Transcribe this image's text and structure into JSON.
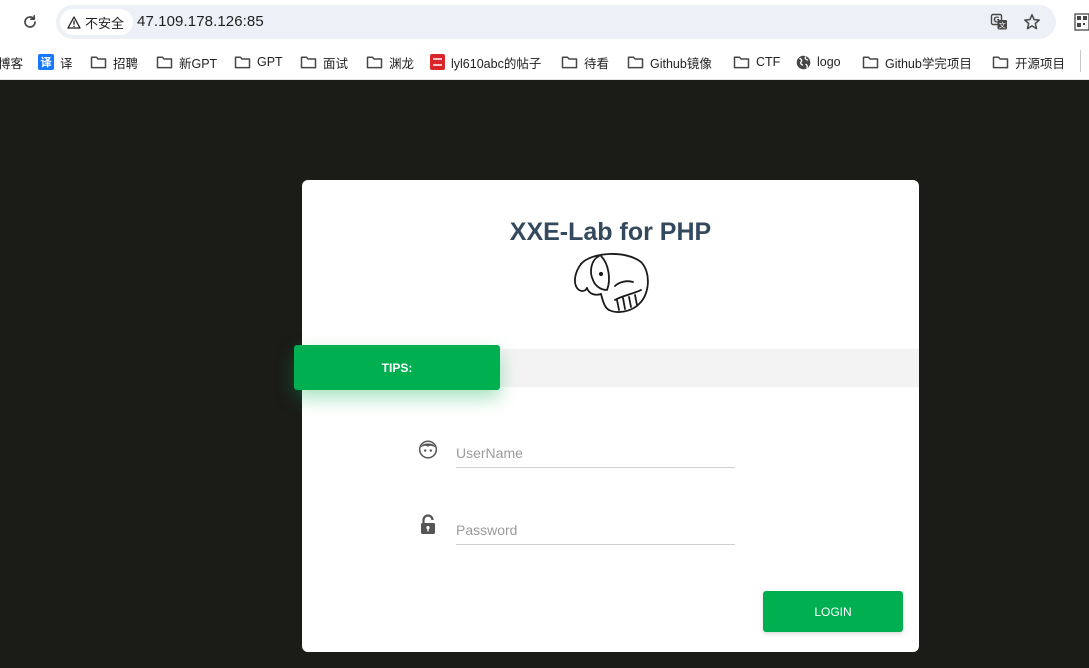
{
  "browser": {
    "security_label": "不安全",
    "url": "47.109.178.126:85",
    "icons": {
      "reload": "reload-icon",
      "warning": "warning-triangle-icon",
      "translate": "translate-icon",
      "bookmark_star": "star-icon",
      "extension": "qr-code-icon"
    }
  },
  "bookmarks": [
    {
      "label": "博客",
      "icon": "none"
    },
    {
      "label": "译",
      "icon": "translate-badge-icon"
    },
    {
      "label": "招聘",
      "icon": "folder-icon"
    },
    {
      "label": "新GPT",
      "icon": "folder-icon"
    },
    {
      "label": "GPT",
      "icon": "folder-icon"
    },
    {
      "label": "面试",
      "icon": "folder-icon"
    },
    {
      "label": "渊龙",
      "icon": "folder-icon"
    },
    {
      "label": "lyl610abc的帖子",
      "icon": "seal-icon"
    },
    {
      "label": "待看",
      "icon": "folder-icon"
    },
    {
      "label": "Github镜像",
      "icon": "folder-icon"
    },
    {
      "label": "CTF",
      "icon": "folder-icon"
    },
    {
      "label": "logo",
      "icon": "globe-icon"
    },
    {
      "label": "Github学完项目",
      "icon": "folder-icon"
    },
    {
      "label": "开源项目",
      "icon": "folder-icon"
    }
  ],
  "login": {
    "title": "XXE-Lab for PHP",
    "logo_icon": "php-elephant-icon",
    "tips_label": "TIPS:",
    "username_placeholder": "UserName",
    "password_placeholder": "Password",
    "username_value": "",
    "password_value": "",
    "username_icon": "user-face-icon",
    "password_icon": "lock-icon",
    "login_label": "LOGIN"
  },
  "colors": {
    "page_background": "#1b1b18",
    "accent_green": "#00b050",
    "title_color": "#34495e",
    "tips_bar": "#f3f3f3"
  }
}
